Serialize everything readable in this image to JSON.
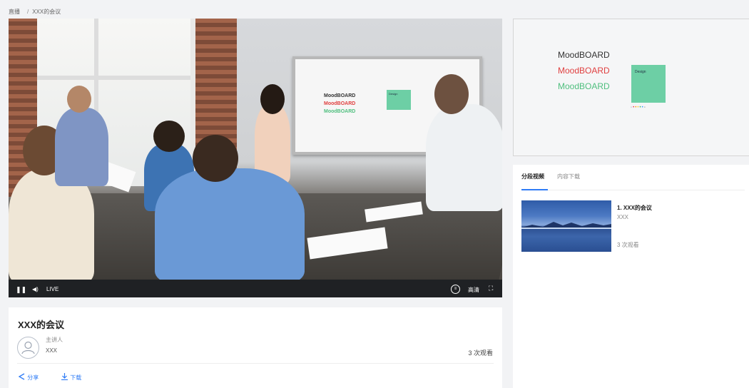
{
  "breadcrumb": {
    "root": "直播",
    "current": "XXX的会议"
  },
  "player": {
    "live_label": "LIVE",
    "quality_label": "高清",
    "progress": 0.005,
    "board": {
      "line1": "MoodBOARD",
      "line2": "MoodBOARD",
      "line3": "MoodBOARD",
      "note": "Design"
    }
  },
  "meeting": {
    "title": "XXX的会议",
    "presenter_role": "主讲人",
    "presenter_name": "XXX",
    "views": "3 次观看",
    "share_label": "分享",
    "download_label": "下载"
  },
  "preview": {
    "line1": "MoodBOARD",
    "line2": "MoodBOARD",
    "line3": "MoodBOARD",
    "note": "Design"
  },
  "side": {
    "tabs": [
      {
        "label": "分段视频",
        "active": true
      },
      {
        "label": "内容下载",
        "active": false
      }
    ],
    "segments": [
      {
        "title": "1. XXX的会议",
        "subtitle": "XXX",
        "views": "3 次观看"
      }
    ]
  },
  "colors": {
    "accent": "#2f7cf6",
    "note_green": "#6dcfa5",
    "red_text": "#e04040",
    "green_text": "#4fbf7e"
  }
}
